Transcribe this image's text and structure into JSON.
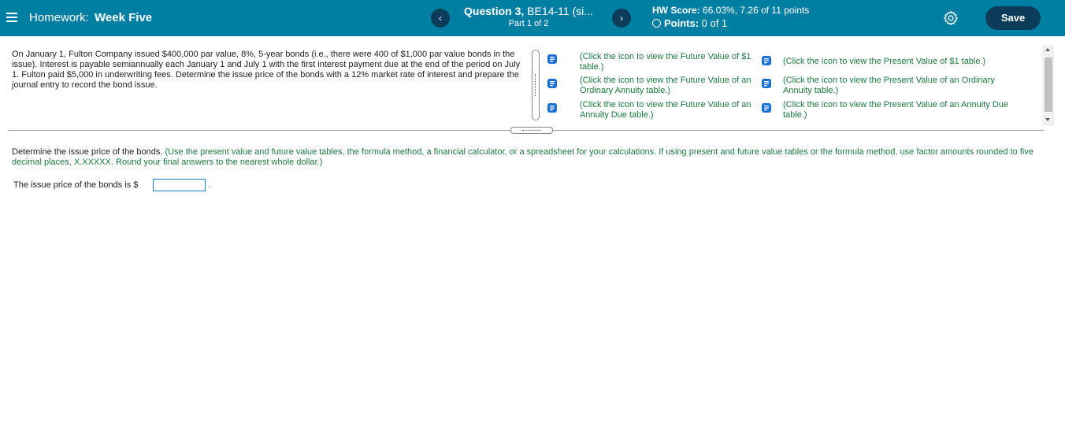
{
  "header": {
    "homework_prefix": "Homework:",
    "homework_name": "Week Five",
    "question_label": "Question 3,",
    "question_id": " BE14-11 (si...",
    "part": "Part 1 of 2",
    "score_label": "HW Score:",
    "score_value": " 66.03%, 7.26 of 11 points",
    "points_label": "Points:",
    "points_value": " 0 of 1",
    "prev_symbol": "‹",
    "next_symbol": "›",
    "save_label": "Save"
  },
  "problem": {
    "text": "On January 1, Fulton Company issued $400,000 par value, 8%, 5-year bonds (i.e., there were 400 of $1,000 par value bonds in the issue). Interest is payable semiannually each January 1 and July 1 with the first interest payment due at the end of the period on July 1. Fulton paid $5,000 in underwriting fees. Determine the issue price of the bonds with a 12% market rate of interest and prepare the journal entry to record the bond issue."
  },
  "links": [
    "(Click the icon to view the Future Value of $1 table.)",
    "(Click the icon to view the Present Value of $1 table.)",
    "(Click the icon to view the Future Value of an Ordinary Annuity table.)",
    "(Click the icon to view the Present Value of an Ordinary Annuity table.)",
    "(Click the icon to view the Future Value of an Annuity Due table.)",
    "(Click the icon to view the Present Value of an Annuity Due table.)"
  ],
  "instruction": {
    "main": "Determine the issue price of the bonds.",
    "note": " (Use the present value and future value tables, the formula method, a financial calculator, or a spreadsheet for your calculations. If using present and future value tables or the formula method, use factor amounts rounded to five decimal places, X.XXXXX. Round your final answers to the nearest whole dollar.)"
  },
  "answer": {
    "label": "The issue price of the bonds is $",
    "value": "",
    "suffix": "."
  },
  "colors": {
    "header_bg": "#007fa3",
    "button_dark": "#0b3d5a",
    "link_green": "#1d7a3d",
    "book_blue": "#1a6fd6"
  }
}
